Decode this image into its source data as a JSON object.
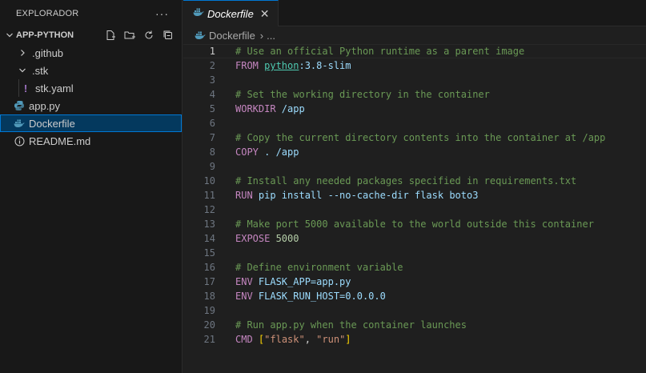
{
  "sidebar": {
    "title": "EXPLORADOR",
    "more": "···",
    "folder": "APP-PYTHON",
    "items": [
      {
        "label": ".github"
      },
      {
        "label": ".stk"
      },
      {
        "label": "stk.yaml"
      },
      {
        "label": "app.py"
      },
      {
        "label": "Dockerfile"
      },
      {
        "label": "README.md"
      }
    ]
  },
  "tab": {
    "label": "Dockerfile",
    "close": "✕"
  },
  "breadcrumb": {
    "file": "Dockerfile",
    "sep": "›",
    "more": "..."
  },
  "code": {
    "active_line": 1,
    "lines": [
      {
        "n": "1",
        "t": [
          [
            "c-comment",
            "# Use an official Python runtime as a parent image"
          ]
        ]
      },
      {
        "n": "2",
        "t": [
          [
            "c-kw",
            "FROM "
          ],
          [
            "c-image",
            "python"
          ],
          [
            "c-id",
            ":3.8-slim"
          ]
        ]
      },
      {
        "n": "3",
        "t": []
      },
      {
        "n": "4",
        "t": [
          [
            "c-comment",
            "# Set the working directory in the container"
          ]
        ]
      },
      {
        "n": "5",
        "t": [
          [
            "c-kw",
            "WORKDIR "
          ],
          [
            "c-id",
            "/app"
          ]
        ]
      },
      {
        "n": "6",
        "t": []
      },
      {
        "n": "7",
        "t": [
          [
            "c-comment",
            "# Copy the current directory contents into the container at /app"
          ]
        ]
      },
      {
        "n": "8",
        "t": [
          [
            "c-kw",
            "COPY "
          ],
          [
            "c-id",
            ". /app"
          ]
        ]
      },
      {
        "n": "9",
        "t": []
      },
      {
        "n": "10",
        "t": [
          [
            "c-comment",
            "# Install any needed packages specified in requirements.txt"
          ]
        ]
      },
      {
        "n": "11",
        "t": [
          [
            "c-kw",
            "RUN "
          ],
          [
            "c-id",
            "pip install --no-cache-dir flask boto3"
          ]
        ]
      },
      {
        "n": "12",
        "t": []
      },
      {
        "n": "13",
        "t": [
          [
            "c-comment",
            "# Make port 5000 available to the world outside this container"
          ]
        ]
      },
      {
        "n": "14",
        "t": [
          [
            "c-kw",
            "EXPOSE "
          ],
          [
            "c-num",
            "5000"
          ]
        ]
      },
      {
        "n": "15",
        "t": []
      },
      {
        "n": "16",
        "t": [
          [
            "c-comment",
            "# Define environment variable"
          ]
        ]
      },
      {
        "n": "17",
        "t": [
          [
            "c-kw",
            "ENV "
          ],
          [
            "c-id",
            "FLASK_APP=app.py"
          ]
        ]
      },
      {
        "n": "18",
        "t": [
          [
            "c-kw",
            "ENV "
          ],
          [
            "c-id",
            "FLASK_RUN_HOST=0.0.0.0"
          ]
        ]
      },
      {
        "n": "19",
        "t": []
      },
      {
        "n": "20",
        "t": [
          [
            "c-comment",
            "# Run app.py when the container launches"
          ]
        ]
      },
      {
        "n": "21",
        "t": [
          [
            "c-kw",
            "CMD "
          ],
          [
            "c-bracket",
            "["
          ],
          [
            "c-str",
            "\"flask\""
          ],
          [
            "c-plain",
            ", "
          ],
          [
            "c-str",
            "\"run\""
          ],
          [
            "c-bracket",
            "]"
          ]
        ]
      }
    ]
  }
}
